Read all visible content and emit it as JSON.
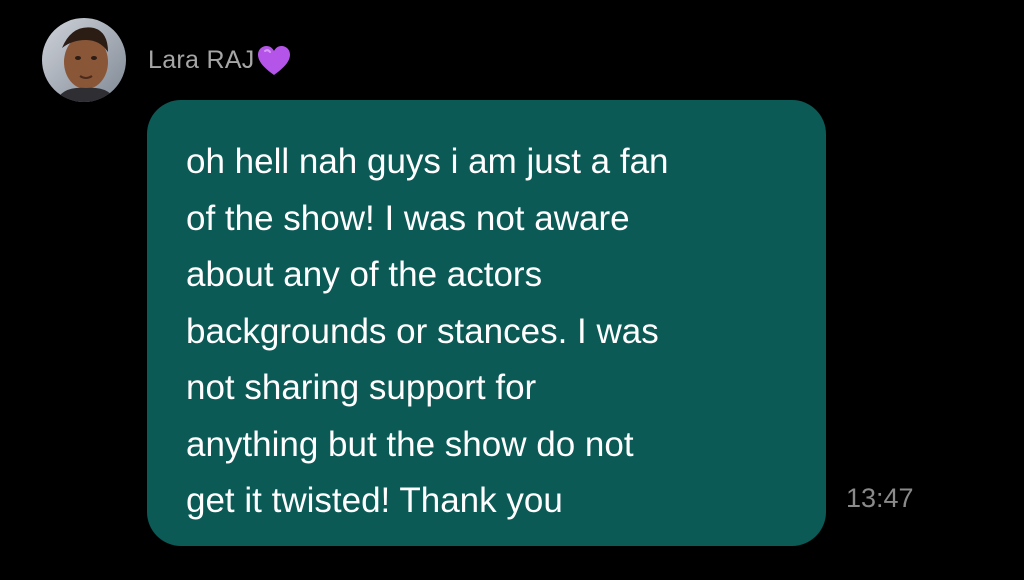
{
  "sender": {
    "name": "Lara RAJ",
    "badge_icon": "purple-heart-icon",
    "badge_color": "#b554e8"
  },
  "message": {
    "text": "oh hell nah guys i am just a fan\nof the show! I was not aware\nabout any of the actors\nbackgrounds or stances. I was\nnot sharing support for\nanything but the show do not\nget it twisted! Thank you",
    "time": "13:47",
    "bubble_color": "#0b5a56"
  }
}
